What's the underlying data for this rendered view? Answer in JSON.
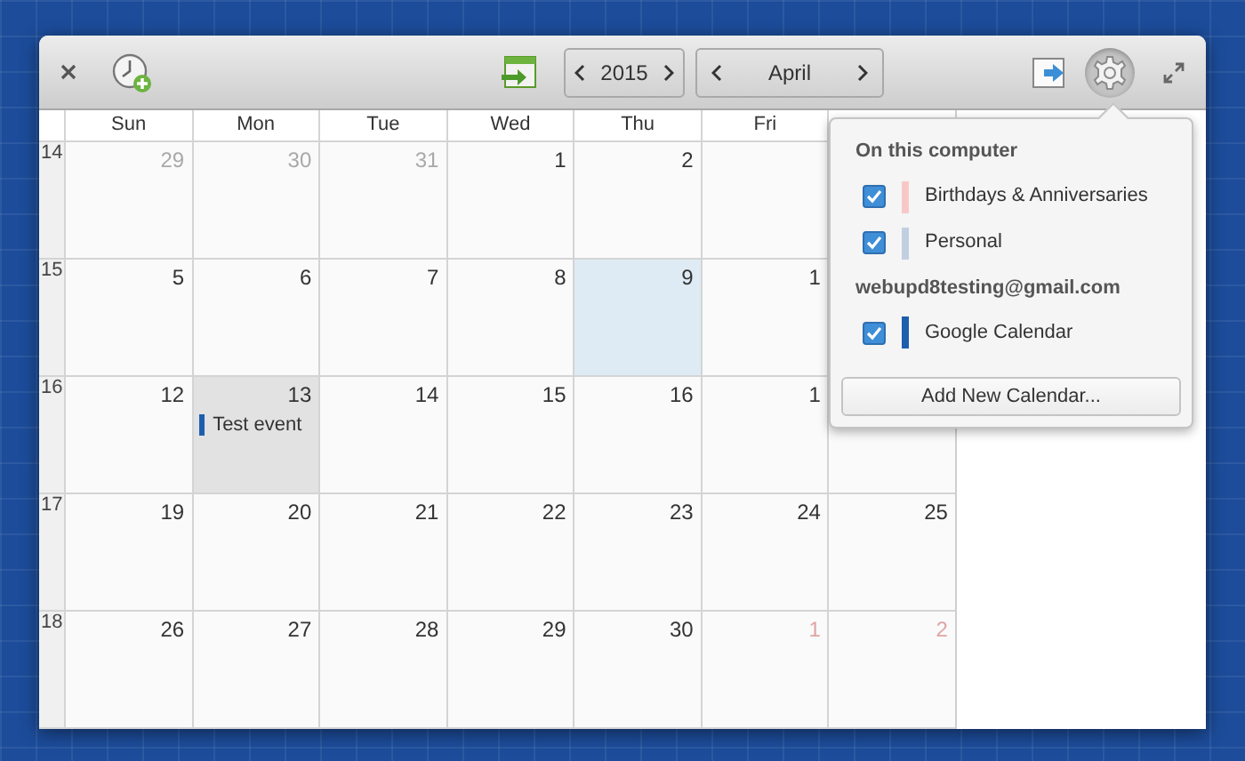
{
  "toolbar": {
    "year": "2015",
    "month": "April",
    "settings_pressed": true
  },
  "weekdays": [
    "Sun",
    "Mon",
    "Tue",
    "Wed",
    "Thu",
    "Fri"
  ],
  "weeks": [
    {
      "number": "14",
      "days": [
        {
          "date": "29",
          "kind": "previous"
        },
        {
          "date": "30",
          "kind": "previous"
        },
        {
          "date": "31",
          "kind": "previous"
        },
        {
          "date": "1",
          "kind": "current"
        },
        {
          "date": "2",
          "kind": "current"
        }
      ]
    },
    {
      "number": "15",
      "days": [
        {
          "date": "5",
          "kind": "current"
        },
        {
          "date": "6",
          "kind": "current"
        },
        {
          "date": "7",
          "kind": "current"
        },
        {
          "date": "8",
          "kind": "current"
        },
        {
          "date": "9",
          "kind": "current",
          "today": true
        },
        {
          "date": "1",
          "kind": "current"
        }
      ]
    },
    {
      "number": "16",
      "days": [
        {
          "date": "12",
          "kind": "current"
        },
        {
          "date": "13",
          "kind": "current",
          "selected": true,
          "events": [
            {
              "title": "Test event"
            }
          ]
        },
        {
          "date": "14",
          "kind": "current"
        },
        {
          "date": "15",
          "kind": "current"
        },
        {
          "date": "16",
          "kind": "current"
        },
        {
          "date": "1",
          "kind": "current"
        }
      ]
    },
    {
      "number": "17",
      "days": [
        {
          "date": "19",
          "kind": "current"
        },
        {
          "date": "20",
          "kind": "current"
        },
        {
          "date": "21",
          "kind": "current"
        },
        {
          "date": "22",
          "kind": "current"
        },
        {
          "date": "23",
          "kind": "current"
        },
        {
          "date": "24",
          "kind": "current"
        },
        {
          "date": "25",
          "kind": "current"
        }
      ]
    },
    {
      "number": "18",
      "days": [
        {
          "date": "26",
          "kind": "current"
        },
        {
          "date": "27",
          "kind": "current"
        },
        {
          "date": "28",
          "kind": "current"
        },
        {
          "date": "29",
          "kind": "current"
        },
        {
          "date": "30",
          "kind": "current"
        },
        {
          "date": "1",
          "kind": "next"
        },
        {
          "date": "2",
          "kind": "next"
        }
      ]
    }
  ],
  "popover": {
    "sections": [
      {
        "heading": "On this computer",
        "calendars": [
          {
            "name": "Birthdays & Anniversaries",
            "checked": true,
            "color": "#f8c8c8"
          },
          {
            "name": "Personal",
            "checked": true,
            "color": "#c0d0e2"
          }
        ]
      },
      {
        "heading": "webupd8testing@gmail.com",
        "calendars": [
          {
            "name": "Google Calendar",
            "checked": true,
            "color": "#1c5fae"
          }
        ]
      }
    ],
    "button": "Add New Calendar..."
  }
}
